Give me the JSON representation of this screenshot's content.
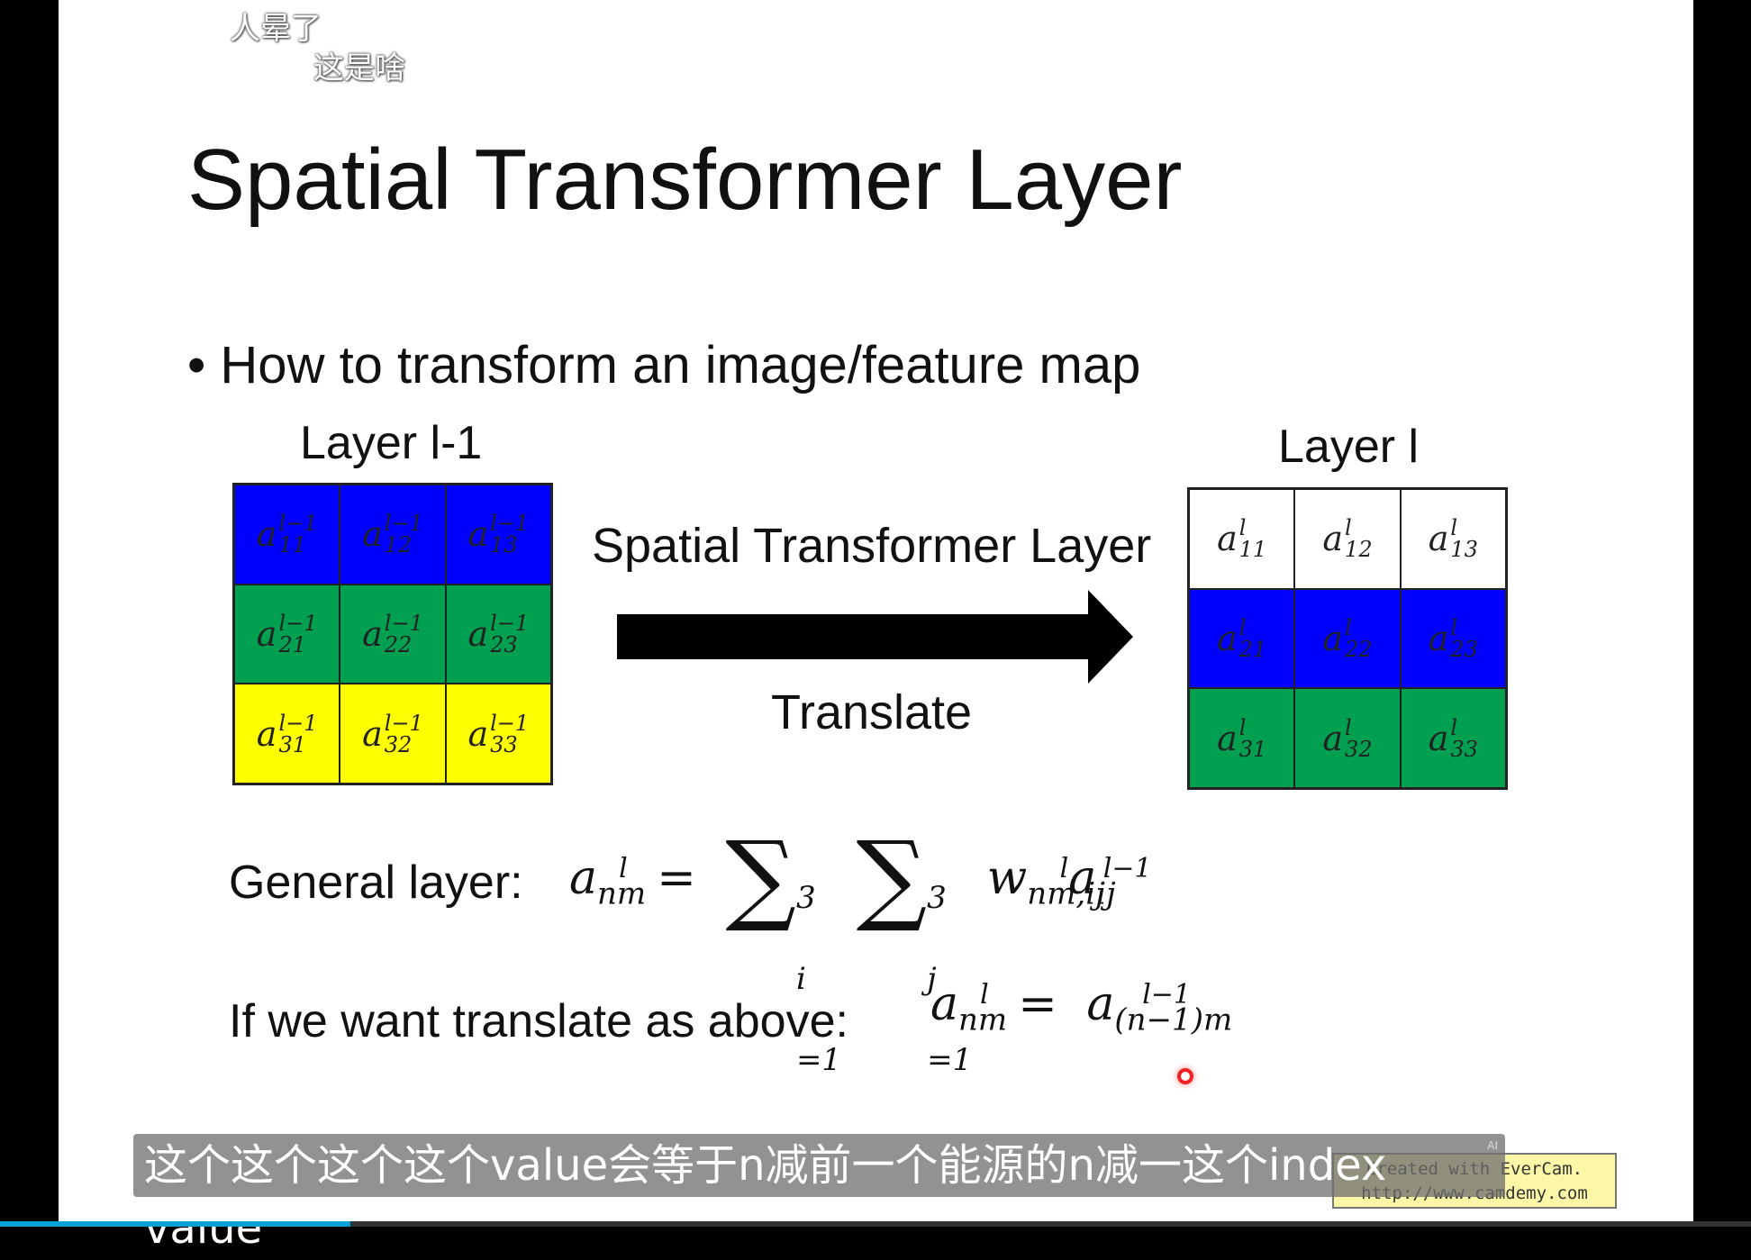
{
  "danmaku": [
    "人晕了",
    "这是啥"
  ],
  "slide": {
    "title": "Spatial Transformer Layer",
    "bullet": "How to transform an image/feature map",
    "left_label": "Layer l-1",
    "right_label": "Layer l",
    "arrow_top": "Spatial Transformer Layer",
    "arrow_bottom": "Translate",
    "left_grid": [
      [
        "11",
        "12",
        "13"
      ],
      [
        "21",
        "22",
        "23"
      ],
      [
        "31",
        "32",
        "33"
      ]
    ],
    "left_sup": "l−1",
    "right_sup": "l",
    "left_colors": [
      "#0000ff",
      "#00a050",
      "#ffff00"
    ],
    "right_colors": [
      "#ffffff",
      "#0000ff",
      "#00a050"
    ],
    "general_label": "General layer:",
    "translate_label": "If we want translate as above:"
  },
  "subtitle": {
    "text": "这个这个这个这个value会等于n减前一个能源的n减一这个index value",
    "badge": "AI"
  },
  "watermark": {
    "line1": "Created with EverCam.",
    "line2": "http://www.camdemy.com"
  },
  "player": {
    "progress": 0.2
  }
}
